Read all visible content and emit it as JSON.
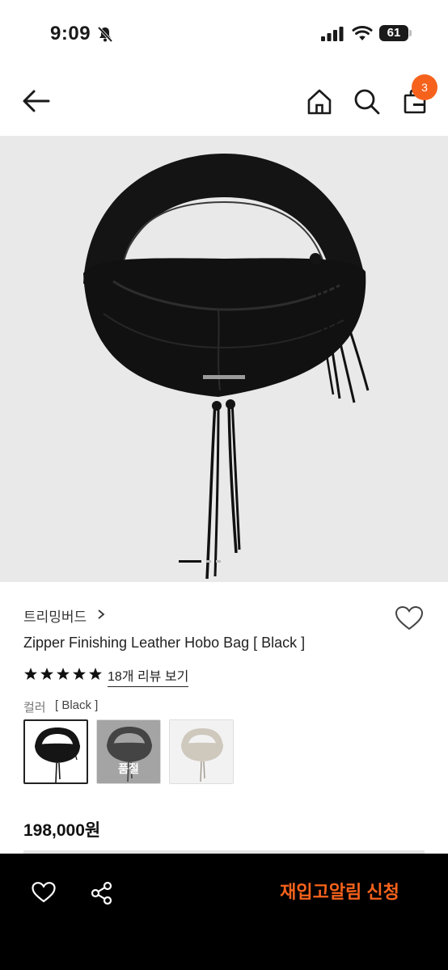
{
  "status_bar": {
    "time": "9:09",
    "battery": "61"
  },
  "header": {
    "cart_count": "3"
  },
  "hero": {
    "slide_count": 3,
    "active_slide": 1
  },
  "product": {
    "brand": "트리밍버드",
    "title": "Zipper Finishing Leather Hobo Bag [ Black ]",
    "rating_stars": 5,
    "review_link": "18개 리뷰 보기",
    "color_label": "컬러",
    "color_value": "[ Black ]",
    "variants": [
      {
        "color": "Black",
        "selected": true,
        "soldout_label": ""
      },
      {
        "color": "Dark grey",
        "selected": false,
        "soldout_label": "품절"
      },
      {
        "color": "Silver",
        "selected": false,
        "soldout_label": ""
      }
    ],
    "price": "198,000원"
  },
  "bottom_bar": {
    "restock_label": "재입고알림 신청"
  },
  "colors": {
    "accent": "#f6621c",
    "bottom_bar_bg": "#000000",
    "hero_bg": "#e9e9e9"
  }
}
